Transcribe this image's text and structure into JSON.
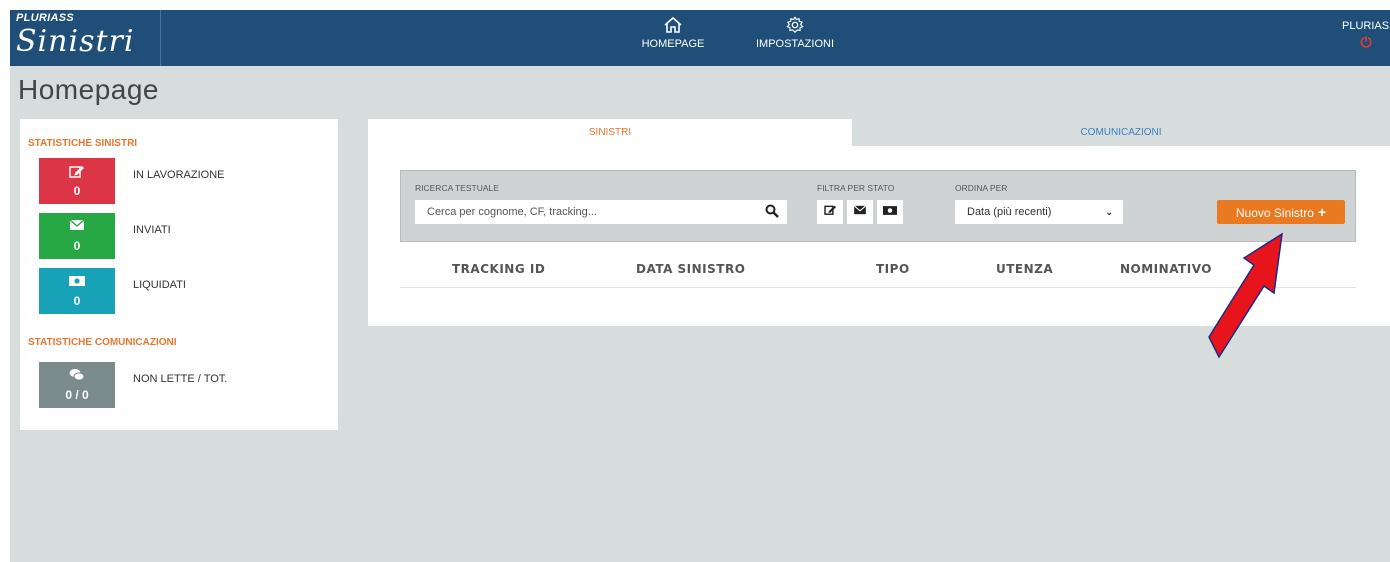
{
  "brand": {
    "small": "PLURIASS",
    "big": "Sinistri"
  },
  "nav": {
    "home": "HOMEPAGE",
    "settings": "IMPOSTAZIONI"
  },
  "user": {
    "name": "PLURIASS"
  },
  "page_title": "Homepage",
  "stats": {
    "sinistri_heading": "STATISTICHE SINISTRI",
    "items": [
      {
        "label": "IN LAVORAZIONE",
        "count": "0",
        "color": "#dc3545",
        "icon": "edit-icon"
      },
      {
        "label": "INVIATI",
        "count": "0",
        "color": "#28a745",
        "icon": "envelope-icon"
      },
      {
        "label": "LIQUIDATI",
        "count": "0",
        "color": "#17a2b8",
        "icon": "money-icon"
      }
    ],
    "comunicazioni_heading": "STATISTICHE COMUNICAZIONI",
    "comunicazioni": {
      "label": "NON LETTE / TOT.",
      "count": "0 / 0",
      "color": "#7b8a8b",
      "icon": "comments-icon"
    }
  },
  "tabs": {
    "sinistri": "SINISTRI",
    "comunicazioni": "COMUNICAZIONI"
  },
  "filters": {
    "search_label": "RICERCA TESTUALE",
    "search_placeholder": "Cerca per cognome, CF, tracking...",
    "status_label": "FILTRA PER STATO",
    "order_label": "ORDINA PER",
    "order_value": "Data (più recenti)",
    "new_button": "Nuovo Sinistro"
  },
  "table": {
    "columns": [
      "TRACKING ID",
      "DATA SINISTRO",
      "TIPO",
      "UTENZA",
      "NOMINATIVO"
    ]
  },
  "colors": {
    "topbar": "#1f4f78",
    "accent": "#ea7a21",
    "arrow": "#e8141c"
  }
}
